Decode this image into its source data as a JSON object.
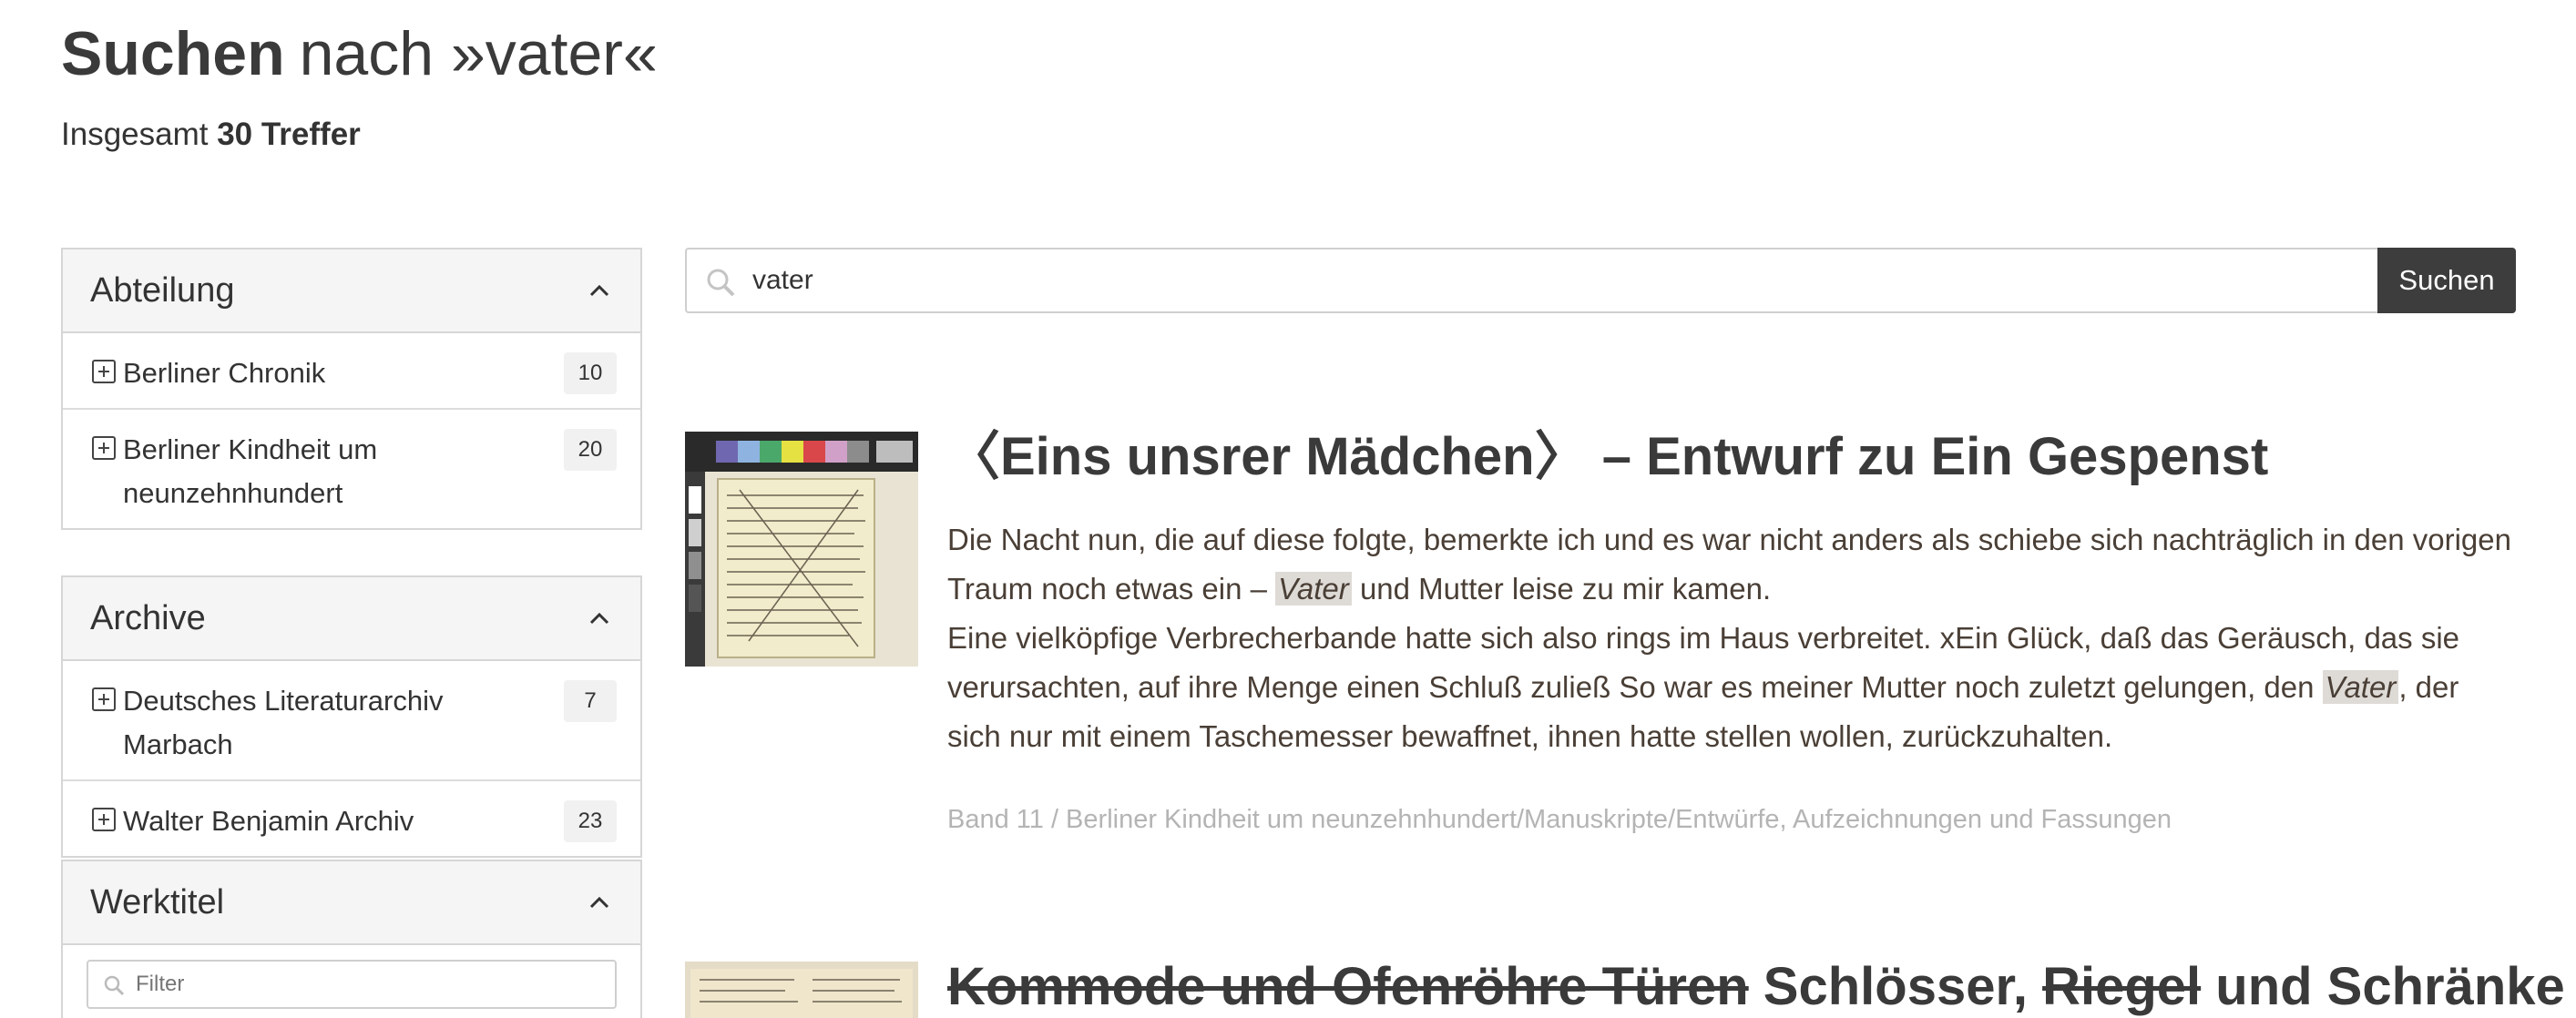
{
  "header": {
    "title_strong": "Suchen",
    "title_rest": "nach »vater«",
    "total_prefix": "Insgesamt",
    "total_count": "30 Treffer"
  },
  "sidebar": {
    "abteilung": {
      "title": "Abteilung",
      "items": [
        {
          "label": "Berliner Chronik",
          "count": "10"
        },
        {
          "label": "Berliner Kindheit um neunzehnhundert",
          "count": "20"
        }
      ]
    },
    "archive": {
      "title": "Archive",
      "items": [
        {
          "label": "Deutsches Literaturarchiv Marbach",
          "count": "7"
        },
        {
          "label": "Walter Benjamin Archiv",
          "count": "23"
        }
      ]
    },
    "werktitel": {
      "title": "Werktitel",
      "filter_placeholder": "Filter"
    }
  },
  "search": {
    "value": "vater",
    "button_label": "Suchen"
  },
  "results": [
    {
      "title": "〈Eins unsrer Mädchen〉 – Entwurf zu Ein Gespenst",
      "excerpt_1a": "Die Nacht nun, die auf diese folgte, bemerkte ich und es war nicht anders als schiebe sich nachträglich in den vorigen Traum noch etwas ein – ",
      "highlight_1": "Vater",
      "excerpt_1b": " und Mutter leise zu mir kamen.",
      "excerpt_2a": "Eine vielköpfige Verbrecherbande hatte sich also rings im Haus verbreitet. xEin Glück, daß das Geräusch, das sie verursachten, auf ihre Menge einen Schluß zuließ So war es meiner Mutter noch zuletzt gelungen, den ",
      "highlight_2": "Vater",
      "excerpt_2b": ", der sich nur mit einem Taschemesser bewaffnet, ihnen hatte stellen wollen, zurückzuhalten.",
      "meta": "Band 11 / Berliner Kindheit um neunzehnhundert/Manuskripte/Entwürfe, Aufzeichnungen und Fassungen"
    },
    {
      "title_strike_1": "Kommode und Ofenröhre Türen",
      "title_mid": " Schlösser, ",
      "title_strike_2": "Riegel",
      "title_end": " und Schränke"
    }
  ],
  "colors": {
    "button_bg": "#3d3d3d",
    "highlight_bg": "#dedad6",
    "meta_text": "#b4b4b4",
    "panel_head_bg": "#f5f5f5"
  }
}
